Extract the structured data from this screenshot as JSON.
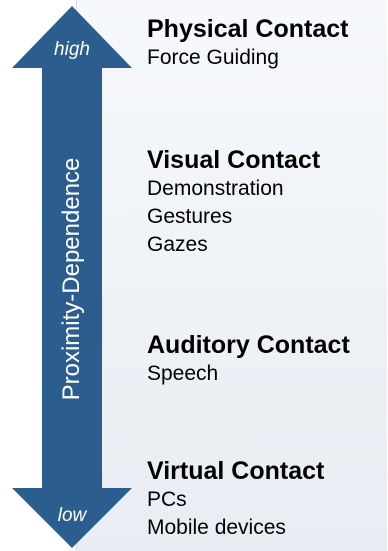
{
  "colors": {
    "arrow": "#2b5d8f",
    "panel": "#eef2f7"
  },
  "axis": {
    "label": "Proximity-Dependence",
    "high": "high",
    "low": "low"
  },
  "groups": [
    {
      "heading": "Physical Contact",
      "items": [
        "Force Guiding"
      ]
    },
    {
      "heading": "Visual Contact",
      "items": [
        "Demonstration",
        "Gestures",
        "Gazes"
      ]
    },
    {
      "heading": "Auditory Contact",
      "items": [
        "Speech"
      ]
    },
    {
      "heading": "Virtual Contact",
      "items": [
        "PCs",
        "Mobile devices"
      ]
    }
  ]
}
